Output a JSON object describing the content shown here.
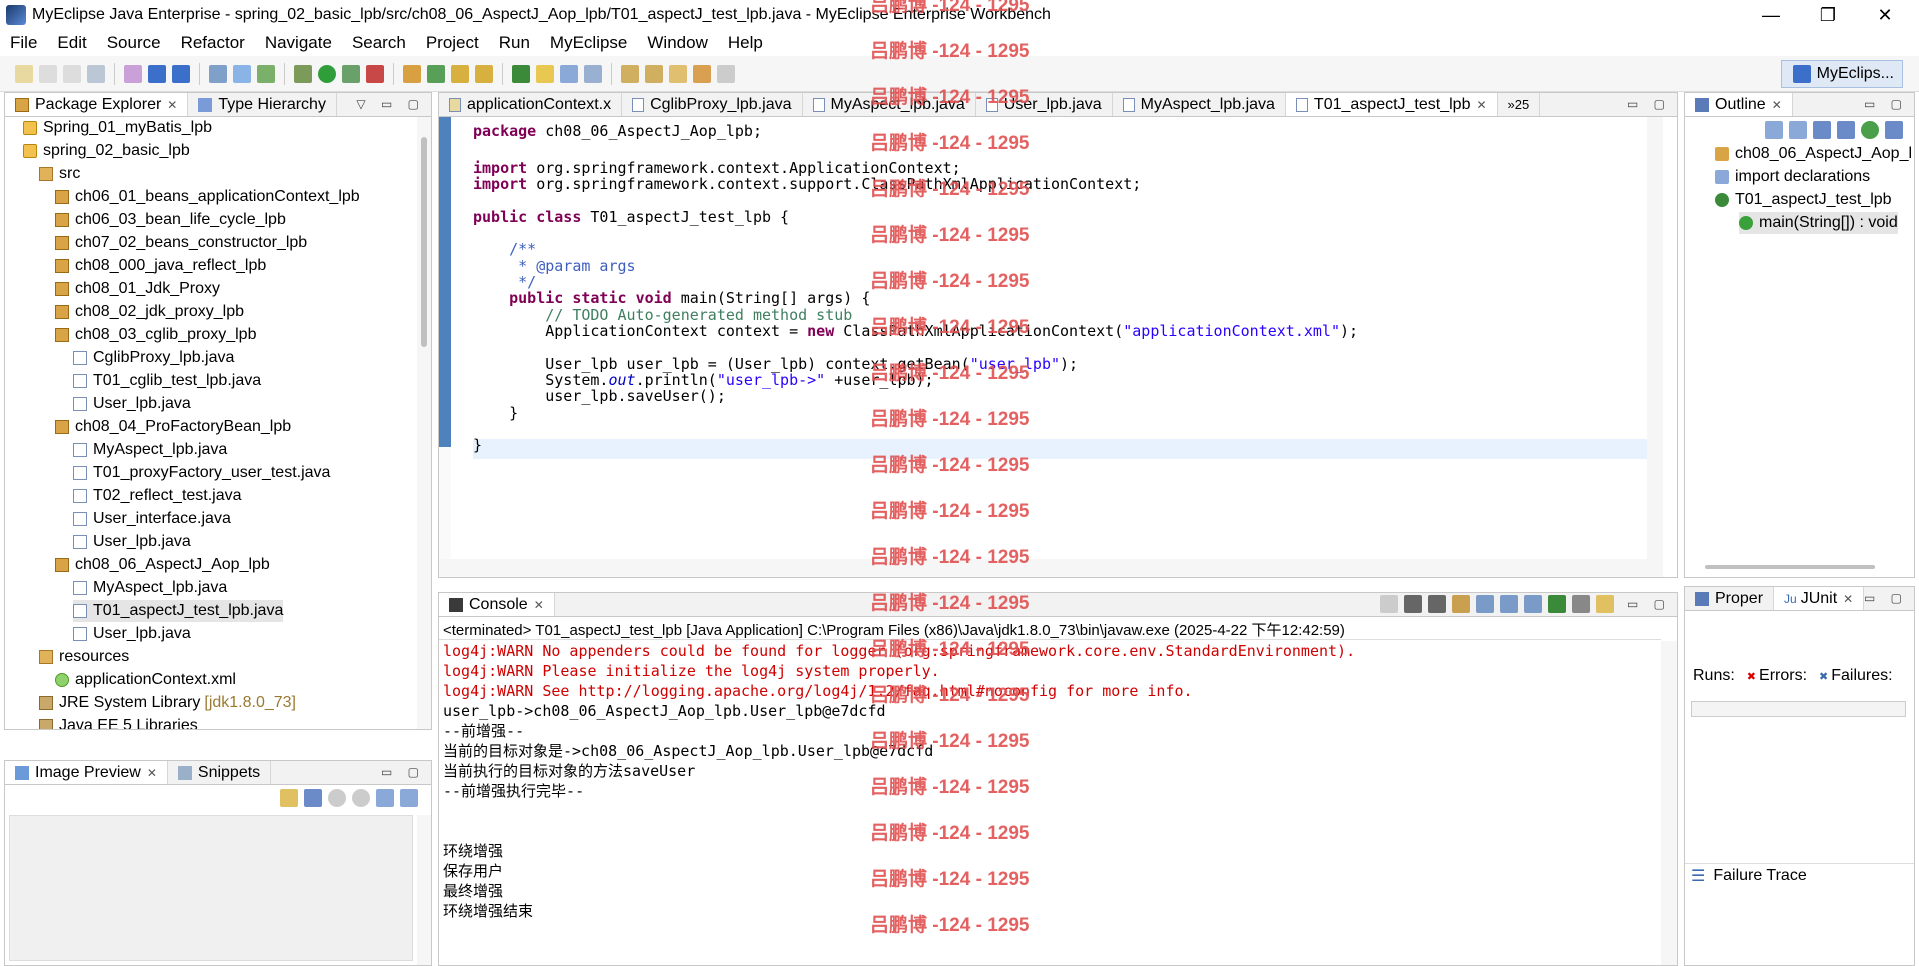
{
  "window": {
    "title": "MyEclipse Java Enterprise - spring_02_basic_lpb/src/ch08_06_AspectJ_Aop_lpb/T01_aspectJ_test_lpb.java - MyEclipse Enterprise Workbench",
    "minimize": "—",
    "restore": "❐",
    "close": "✕"
  },
  "menu": [
    "File",
    "Edit",
    "Source",
    "Refactor",
    "Navigate",
    "Search",
    "Project",
    "Run",
    "MyEclipse",
    "Window",
    "Help"
  ],
  "perspective": "MyEclips...",
  "package_explorer": {
    "tabs": [
      {
        "label": "Package Explorer"
      },
      {
        "label": "Type Hierarchy"
      }
    ],
    "tree": [
      {
        "label": "Spring_01_myBatis_lpb",
        "icon": "project-icon",
        "level": 1
      },
      {
        "label": "spring_02_basic_lpb",
        "icon": "project-icon",
        "level": 1
      },
      {
        "label": "src",
        "icon": "source-folder-icon",
        "level": 2
      },
      {
        "label": "ch06_01_beans_applicationContext_lpb",
        "icon": "package-icon",
        "level": 3
      },
      {
        "label": "ch06_03_bean_life_cycle_lpb",
        "icon": "package-icon",
        "level": 3
      },
      {
        "label": "ch07_02_beans_constructor_lpb",
        "icon": "package-icon",
        "level": 3
      },
      {
        "label": "ch08_000_java_reflect_lpb",
        "icon": "package-icon",
        "level": 3
      },
      {
        "label": "ch08_01_Jdk_Proxy",
        "icon": "package-icon",
        "level": 3
      },
      {
        "label": "ch08_02_jdk_proxy_lpb",
        "icon": "package-icon",
        "level": 3
      },
      {
        "label": "ch08_03_cglib_proxy_lpb",
        "icon": "package-icon",
        "level": 3
      },
      {
        "label": "CglibProxy_lpb.java",
        "icon": "java-file-icon",
        "level": 4
      },
      {
        "label": "T01_cglib_test_lpb.java",
        "icon": "java-file-icon",
        "level": 4
      },
      {
        "label": "User_lpb.java",
        "icon": "java-file-icon",
        "level": 4
      },
      {
        "label": "ch08_04_ProFactoryBean_lpb",
        "icon": "package-icon",
        "level": 3
      },
      {
        "label": "MyAspect_lpb.java",
        "icon": "java-file-icon",
        "level": 4
      },
      {
        "label": "T01_proxyFactory_user_test.java",
        "icon": "java-file-icon",
        "level": 4
      },
      {
        "label": "T02_reflect_test.java",
        "icon": "java-file-icon",
        "level": 4
      },
      {
        "label": "User_interface.java",
        "icon": "java-file-icon",
        "level": 4
      },
      {
        "label": "User_lpb.java",
        "icon": "java-file-icon",
        "level": 4
      },
      {
        "label": "ch08_06_AspectJ_Aop_lpb",
        "icon": "package-icon",
        "level": 3
      },
      {
        "label": "MyAspect_lpb.java",
        "icon": "java-file-icon",
        "level": 4
      },
      {
        "label": "T01_aspectJ_test_lpb.java",
        "icon": "java-file-icon",
        "level": 4,
        "selected": true
      },
      {
        "label": "User_lpb.java",
        "icon": "java-file-icon",
        "level": 4
      },
      {
        "label": "resources",
        "icon": "source-folder-icon",
        "level": 2
      },
      {
        "label": "applicationContext.xml",
        "icon": "xml-file-icon",
        "level": 3
      },
      {
        "label": "JRE System Library",
        "extra": "[jdk1.8.0_73]",
        "icon": "library-icon",
        "level": 2
      },
      {
        "label": "Java EE 5 Libraries",
        "icon": "library-icon",
        "level": 2
      }
    ]
  },
  "image_preview": {
    "tabs": [
      {
        "label": "Image Preview"
      },
      {
        "label": "Snippets"
      }
    ]
  },
  "editor": {
    "tabs": [
      {
        "label": "applicationContext.x"
      },
      {
        "label": "CglibProxy_lpb.java"
      },
      {
        "label": "MyAspect_lpb.java"
      },
      {
        "label": "User_lpb.java"
      },
      {
        "label": "MyAspect_lpb.java"
      },
      {
        "label": "T01_aspectJ_test_lpb",
        "active": true
      }
    ],
    "overflow": "»25",
    "lines": [
      [
        {
          "t": "package ",
          "c": "kw"
        },
        {
          "t": "ch08_06_AspectJ_Aop_lpb;"
        }
      ],
      [],
      [
        {
          "t": "import ",
          "c": "kw"
        },
        {
          "t": "org.springframework.context.ApplicationContext;"
        }
      ],
      [
        {
          "t": "import ",
          "c": "kw"
        },
        {
          "t": "org.springframework.context.support.ClassPathXmlApplicationContext;"
        }
      ],
      [],
      [
        {
          "t": "public ",
          "c": "kw"
        },
        {
          "t": "class ",
          "c": "kw"
        },
        {
          "t": "T01_aspectJ_test_lpb {"
        }
      ],
      [],
      [
        {
          "t": "    /**",
          "c": "jd"
        }
      ],
      [
        {
          "t": "     * @param args",
          "c": "jd"
        }
      ],
      [
        {
          "t": "     */",
          "c": "jd"
        }
      ],
      [
        {
          "t": "    "
        },
        {
          "t": "public ",
          "c": "kw"
        },
        {
          "t": "static ",
          "c": "kw"
        },
        {
          "t": "void ",
          "c": "kw"
        },
        {
          "t": "main(String[] args) {"
        }
      ],
      [
        {
          "t": "        // TODO Auto-generated method stub",
          "c": "cm"
        }
      ],
      [
        {
          "t": "        ApplicationContext context = "
        },
        {
          "t": "new ",
          "c": "kw"
        },
        {
          "t": "ClassPathXmlApplicationContext("
        },
        {
          "t": "\"applicationContext.xml\"",
          "c": "st"
        },
        {
          "t": ");"
        }
      ],
      [],
      [
        {
          "t": "        User_lpb user_lpb = (User_lpb) context.getBean("
        },
        {
          "t": "\"user_lpb\"",
          "c": "st"
        },
        {
          "t": ");"
        }
      ],
      [
        {
          "t": "        System."
        },
        {
          "t": "out",
          "c": "it"
        },
        {
          "t": ".println("
        },
        {
          "t": "\"user_lpb->\"",
          "c": "st"
        },
        {
          "t": " +user_lpb);"
        }
      ],
      [
        {
          "t": "        user_lpb.saveUser();"
        }
      ],
      [
        {
          "t": "    }"
        }
      ],
      [],
      [
        {
          "t": "}"
        }
      ]
    ]
  },
  "outline": {
    "tabs": [
      {
        "label": "Outline"
      }
    ],
    "items": [
      {
        "label": "ch08_06_AspectJ_Aop_l",
        "level": 1
      },
      {
        "label": "import declarations",
        "level": 1
      },
      {
        "label": "T01_aspectJ_test_lpb",
        "level": 1
      },
      {
        "label": "main(String[]) : void",
        "level": 2,
        "selected": true
      }
    ]
  },
  "junit": {
    "tabs": [
      {
        "label": "Proper"
      },
      {
        "label": "JUnit"
      }
    ],
    "runs_label": "Runs:",
    "errors_label": "Errors:",
    "failures_label": "Failures:",
    "failure_trace_label": "Failure Trace"
  },
  "console": {
    "tabs": [
      {
        "label": "Console"
      }
    ],
    "status": "<terminated> T01_aspectJ_test_lpb [Java Application] C:\\Program Files (x86)\\Java\\jdk1.8.0_73\\bin\\javaw.exe (2025-4-22 下午12:42:59)",
    "lines": [
      {
        "t": "log4j:WARN No appenders could be found for logger (org.springframework.core.env.StandardEnvironment).",
        "err": true
      },
      {
        "t": "log4j:WARN Please initialize the log4j system properly.",
        "err": true
      },
      {
        "t": "log4j:WARN See http://logging.apache.org/log4j/1.2/faq.html#noconfig for more info.",
        "err": true
      },
      {
        "t": "user_lpb->ch08_06_AspectJ_Aop_lpb.User_lpb@e7dcfd"
      },
      {
        "t": "--前增强--"
      },
      {
        "t": "当前的目标对象是->ch08_06_AspectJ_Aop_lpb.User_lpb@e7dcfd"
      },
      {
        "t": "当前执行的目标对象的方法saveUser"
      },
      {
        "t": "--前增强执行完毕--"
      },
      {
        "t": ""
      },
      {
        "t": ""
      },
      {
        "t": "环绕增强"
      },
      {
        "t": "保存用户"
      },
      {
        "t": "最终增强"
      },
      {
        "t": "环绕增强结束"
      }
    ]
  },
  "watermark": {
    "text": "吕鹏博 -124 - 1295",
    "count": 21
  }
}
